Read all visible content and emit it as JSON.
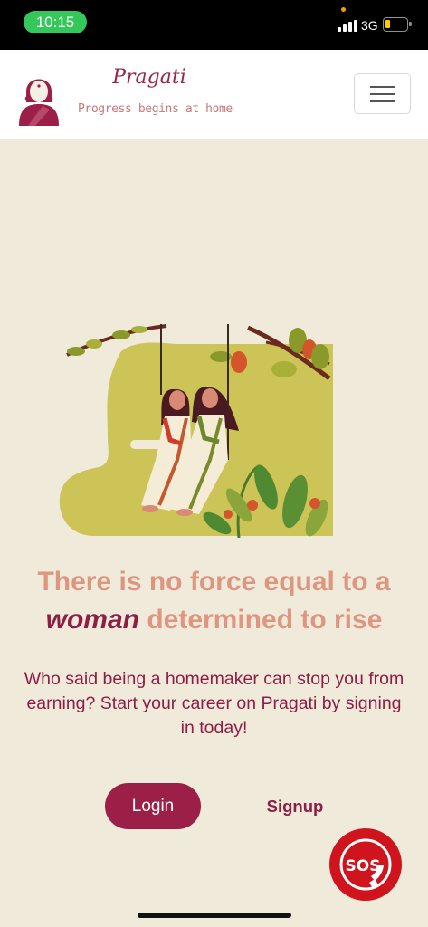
{
  "status_bar": {
    "time": "10:15",
    "network": "3G"
  },
  "navbar": {
    "brand_name": "Pragati",
    "tagline": "Progress begins at home",
    "logo_icon": "woman-avatar-icon",
    "menu_icon": "hamburger-menu-icon"
  },
  "hero": {
    "illustration_icon": "women-on-swing-illustration",
    "headline_part1": "There is no force equal to a",
    "headline_emphasis": "woman",
    "headline_part2": "determined to rise",
    "subtitle": "Who said being a homemaker can stop you from earning? Start your career on Pragati by signing in today!"
  },
  "actions": {
    "login_label": "Login",
    "signup_label": "Signup"
  },
  "sos": {
    "label": "SOS",
    "icon": "sos-phone-icon"
  },
  "colors": {
    "background": "#f0eadb",
    "brand_maroon": "#9c1f48",
    "headline_peach": "#de9680",
    "sos_red": "#d0141d"
  }
}
